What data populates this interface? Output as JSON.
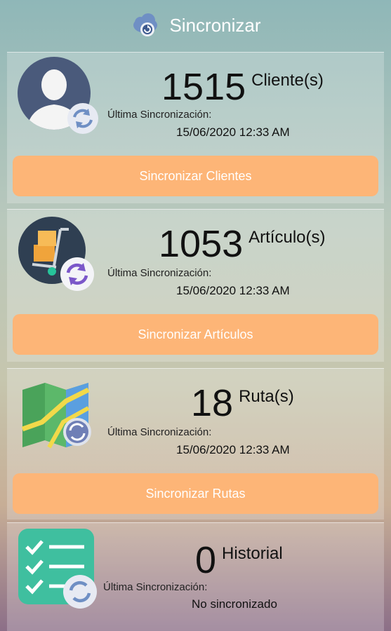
{
  "header": {
    "title": "Sincronizar",
    "icon": "cloud-sync-icon"
  },
  "colors": {
    "button": "#fdb577",
    "accent_sync": "#6f7fb6",
    "sync_purple": "#7b57c9"
  },
  "cards": [
    {
      "icon": "user-avatar-icon",
      "count": "1515",
      "unit": "Cliente(s)",
      "last_sync_label": "Última Sincronización:",
      "last_sync_value": "15/06/2020 12:33 AM",
      "button": "Sincronizar Clientes"
    },
    {
      "icon": "hand-truck-boxes-icon",
      "count": "1053",
      "unit": "Artículo(s)",
      "last_sync_label": "Última Sincronización:",
      "last_sync_value": "15/06/2020 12:33 AM",
      "button": "Sincronizar Artículos"
    },
    {
      "icon": "map-icon",
      "count": "18",
      "unit": "Ruta(s)",
      "last_sync_label": "Última Sincronización:",
      "last_sync_value": "15/06/2020 12:33 AM",
      "button": "Sincronizar Rutas"
    },
    {
      "icon": "checklist-icon",
      "count": "0",
      "unit": "Historial",
      "last_sync_label": "Última Sincronización:",
      "last_sync_value": "No sincronizado"
    }
  ]
}
